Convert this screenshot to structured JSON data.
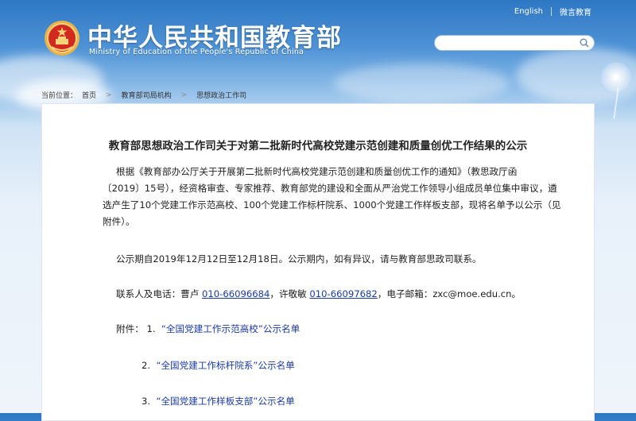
{
  "header": {
    "site_title": "中华人民共和国教育部",
    "site_subtitle": "Ministry of Education of the People's Republic of China",
    "top_links": [
      "English",
      "微言教育"
    ],
    "search": {
      "placeholder": "",
      "value": ""
    }
  },
  "breadcrumb": {
    "prefix": "当前位置：",
    "items": [
      "首页",
      "教育部司局机构",
      "思想政治工作司"
    ],
    "separator": ">"
  },
  "article": {
    "title": "教育部思想政治工作司关于对第二批新时代高校党建示范创建和质量创优工作结果的公示",
    "para1_line1": "根据《教育部办公厅关于开展第二批新时代高校党建示范创建和质量创优工作的通知》（教思政厅函",
    "para1_rest": "〔2019〕15号），经资格审查、专家推荐、教育部党的建设和全面从严治党工作领导小组成员单位集中审议，遴选产生了10个党建工作示范高校、100个党建工作标杆院系、1000个党建工作样板支部，现将名单予以公示（见附件）。",
    "para2": "公示期自2019年12月12日至12月18日。公示期内，如有异议，请与教育部思政司联系。",
    "contact_prefix": "联系人及电话：曹卢 ",
    "phone1": "010-66096684",
    "contact_mid": "，许敬敏 ",
    "phone2": "010-66097682",
    "contact_suffix": "，电子邮箱：zxc@moe.edu.cn。",
    "annex_label": "附件：",
    "annexes": [
      {
        "num": "1.",
        "link": "“全国党建工作示范高校”公示名单"
      },
      {
        "num": "2.",
        "link": "“全国党建工作标杆院系”公示名单"
      },
      {
        "num": "3.",
        "link": "“全国党建工作样板支部”公示名单"
      }
    ]
  }
}
